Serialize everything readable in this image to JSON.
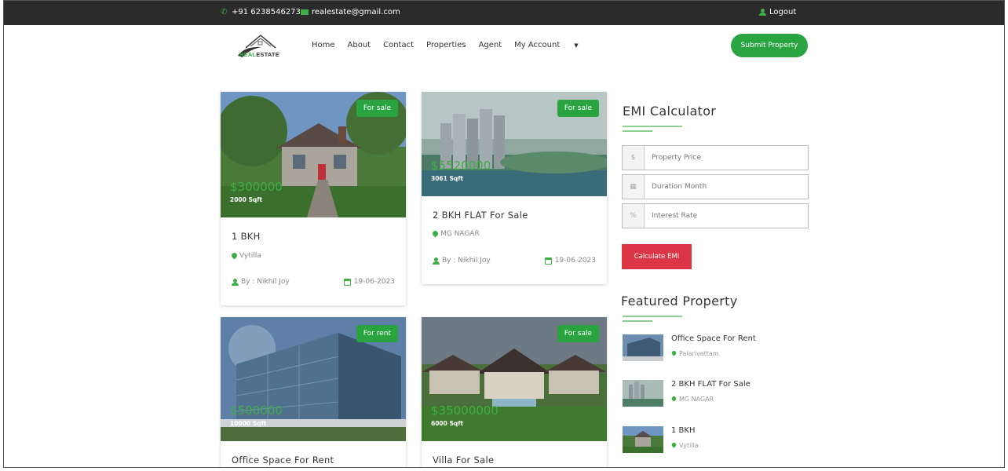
{
  "topbar": {
    "phone": "+91 6238546273",
    "email": "realestate@gmail.com",
    "logout": "Logout",
    "phone_icon": "phone-icon",
    "mail_icon": "mail-icon",
    "user_icon": "user-icon"
  },
  "logo": {
    "part1": "REAL",
    "part2": "ESTATE"
  },
  "nav": {
    "items": [
      "Home",
      "About",
      "Contact",
      "Properties",
      "Agent",
      "My Account"
    ],
    "dropdown_icon": "caret-down-icon"
  },
  "submit_button": "Submit Property",
  "cards": [
    {
      "badge": "For sale",
      "price": "$300000",
      "sqft": "2000 Sqft",
      "title": "1 BKH",
      "location": "Vytilla",
      "by": "By : Nikhil Joy",
      "date": "19-06-2023"
    },
    {
      "badge": "For sale",
      "price": "$5520000",
      "sqft": "3061 Sqft",
      "title": "2 BKH FLAT For Sale",
      "location": "MG NAGAR",
      "by": "By : Nikhil Joy",
      "date": "19-06-2023"
    },
    {
      "badge": "For rent",
      "price": "$500000",
      "sqft": "10000 Sqft",
      "title": "Office Space For Rent"
    },
    {
      "badge": "For sale",
      "price": "$35000000",
      "sqft": "6000 Sqft",
      "title": "Villa For Sale"
    }
  ],
  "emi": {
    "title": "EMI Calculator",
    "fields": [
      {
        "addon": "$",
        "placeholder": "Property Price"
      },
      {
        "addon": "▦",
        "placeholder": "Duration Month"
      },
      {
        "addon": "%",
        "placeholder": "Interest Rate"
      }
    ],
    "button": "Calculate EMI"
  },
  "featured": {
    "title": "Featured Property",
    "items": [
      {
        "name": "Office Space For Rent",
        "location": "Palarivattam"
      },
      {
        "name": "2 BKH FLAT For Sale",
        "location": "MG NAGAR"
      },
      {
        "name": "1 BKH",
        "location": "Vytilla"
      }
    ]
  },
  "colors": {
    "accent": "#2aa341",
    "topbar": "#2b2b2b",
    "danger": "#dc3545"
  }
}
